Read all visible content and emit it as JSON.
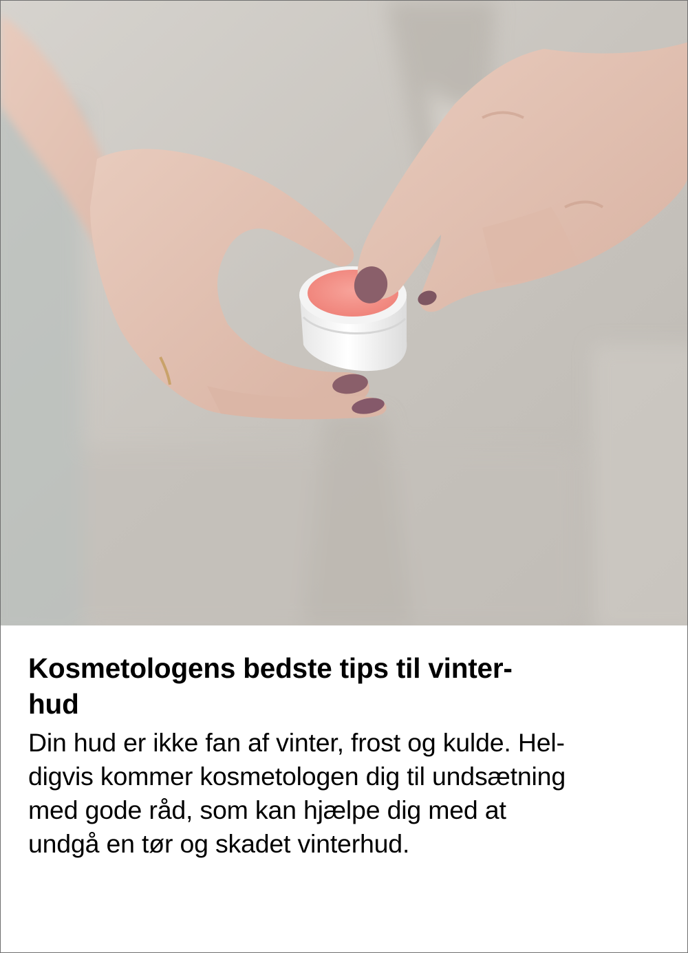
{
  "article": {
    "title_line1": "Kosmetologens bedste tips til vinter-",
    "title_line2": "hud",
    "body_lines": [
      "Din hud er ikke fan af vinter, frost og kulde. Hel-",
      "digvis kommer kosmetologen dig til undsætning",
      "med gode råd, som kan hjælpe dig med at",
      "undgå en tør og skadet vinterhud."
    ]
  },
  "colors": {
    "background": "#ffffff",
    "border": "#6f6f6f",
    "text": "#000000",
    "balm": "#f28b82",
    "nail_polish": "#8a5f6a",
    "apron": "#c9c5bf"
  }
}
